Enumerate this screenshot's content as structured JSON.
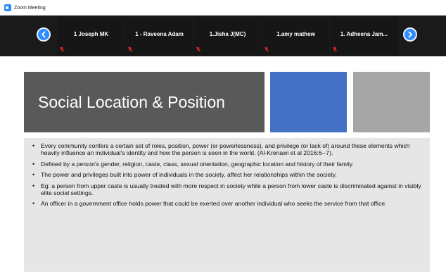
{
  "window": {
    "title": "Zoom Meeting"
  },
  "gallery": {
    "participants": [
      {
        "name": "1 Joseph MK",
        "muted": true
      },
      {
        "name": "1 - Raveena Adam",
        "muted": true
      },
      {
        "name": "1.Jisha J(MC)",
        "muted": true
      },
      {
        "name": "1.amy mathew",
        "muted": true
      },
      {
        "name": "1. Adheena Jam...",
        "muted": true
      }
    ],
    "prev_icon": "chevron-left-icon",
    "next_icon": "chevron-right-icon"
  },
  "slide": {
    "title": "Social Location & Position",
    "bullets": [
      "Every community confers a certain set of roles, position,  power (or powerlessness), and privilege (or lack of) around these elements which heavily influence an individual's identity and how the person is seen in the world. (Al-Krenawi et al 2016:6--7).",
      "Defined by a person's  gender,  religion, caste, class, sexual orientation, geographic location and history of their family.",
      "The power and privileges built into power of individuals in the society, affect her relationships within the society.",
      " Eg: a person from upper caste is usually treated with more respect in society while a person from lower caste is discriminated against in visibly elite social settings.",
      "An officer in a government office holds power that could be exerted over another individual who seeks the service from that office."
    ]
  },
  "colors": {
    "zoom_blue": "#2d8cff",
    "title_bg": "#595959",
    "accent_blue": "#4472c4",
    "accent_gray": "#a6a6a6",
    "content_bg": "#e6e6e6",
    "gallery_bg": "#1a1a1a",
    "mute_red": "#e02828"
  }
}
